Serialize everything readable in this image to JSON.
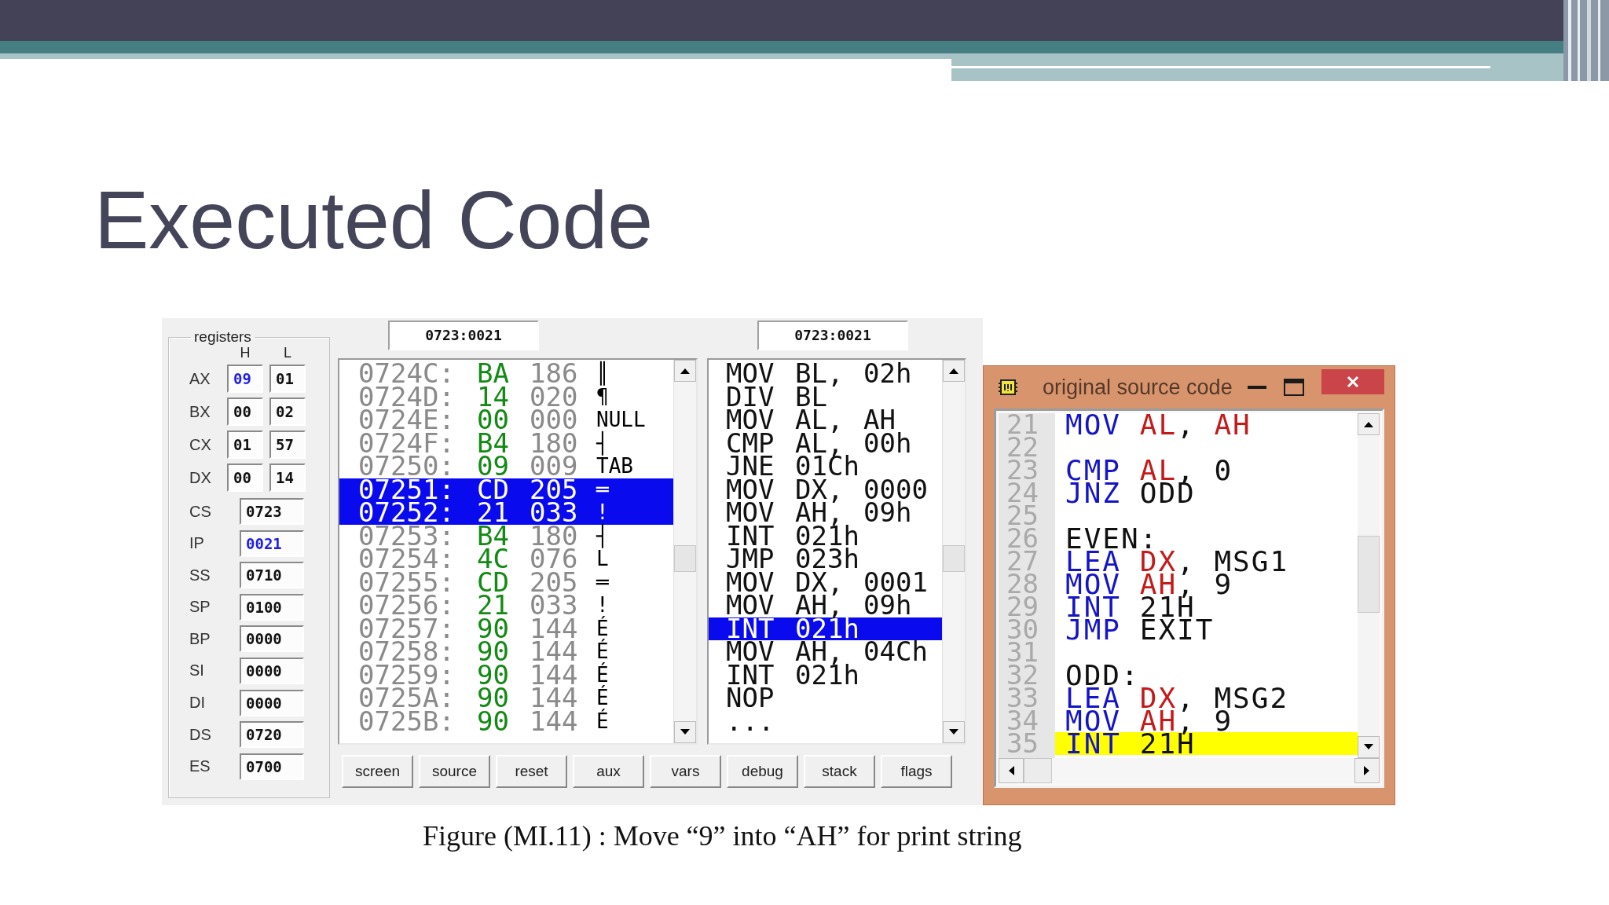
{
  "slide": {
    "title": "Executed Code",
    "caption": "Figure (MI.11) : Move “9” into “AH” for print string"
  },
  "emulator": {
    "registers": {
      "title": "registers",
      "columns": [
        "H",
        "L"
      ],
      "pairs": [
        {
          "name": "AX",
          "h": "09",
          "l": "01",
          "h_changed": true
        },
        {
          "name": "BX",
          "h": "00",
          "l": "02",
          "h_changed": false
        },
        {
          "name": "CX",
          "h": "01",
          "l": "57",
          "h_changed": false
        },
        {
          "name": "DX",
          "h": "00",
          "l": "14",
          "h_changed": false
        }
      ],
      "words": [
        {
          "name": "CS",
          "value": "0723",
          "changed": false
        },
        {
          "name": "IP",
          "value": "0021",
          "changed": true
        },
        {
          "name": "SS",
          "value": "0710",
          "changed": false
        },
        {
          "name": "SP",
          "value": "0100",
          "changed": false
        },
        {
          "name": "BP",
          "value": "0000",
          "changed": false
        },
        {
          "name": "SI",
          "value": "0000",
          "changed": false
        },
        {
          "name": "DI",
          "value": "0000",
          "changed": false
        },
        {
          "name": "DS",
          "value": "0720",
          "changed": false
        },
        {
          "name": "ES",
          "value": "0700",
          "changed": false
        }
      ]
    },
    "memory": {
      "address": "0723:0021",
      "rows": [
        {
          "address": "0724C:",
          "hex": "BA",
          "dec": "186",
          "char": "║",
          "selected": false
        },
        {
          "address": "0724D:",
          "hex": "14",
          "dec": "020",
          "char": "¶",
          "selected": false
        },
        {
          "address": "0724E:",
          "hex": "00",
          "dec": "000",
          "char": "NULL",
          "selected": false
        },
        {
          "address": "0724F:",
          "hex": "B4",
          "dec": "180",
          "char": "┤",
          "selected": false
        },
        {
          "address": "07250:",
          "hex": "09",
          "dec": "009",
          "char": "TAB",
          "selected": false
        },
        {
          "address": "07251:",
          "hex": "CD",
          "dec": "205",
          "char": "═",
          "selected": true
        },
        {
          "address": "07252:",
          "hex": "21",
          "dec": "033",
          "char": "!",
          "selected": true
        },
        {
          "address": "07253:",
          "hex": "B4",
          "dec": "180",
          "char": "┤",
          "selected": false
        },
        {
          "address": "07254:",
          "hex": "4C",
          "dec": "076",
          "char": "L",
          "selected": false
        },
        {
          "address": "07255:",
          "hex": "CD",
          "dec": "205",
          "char": "═",
          "selected": false
        },
        {
          "address": "07256:",
          "hex": "21",
          "dec": "033",
          "char": "!",
          "selected": false
        },
        {
          "address": "07257:",
          "hex": "90",
          "dec": "144",
          "char": "É",
          "selected": false
        },
        {
          "address": "07258:",
          "hex": "90",
          "dec": "144",
          "char": "É",
          "selected": false
        },
        {
          "address": "07259:",
          "hex": "90",
          "dec": "144",
          "char": "É",
          "selected": false
        },
        {
          "address": "0725A:",
          "hex": "90",
          "dec": "144",
          "char": "É",
          "selected": false
        },
        {
          "address": "0725B:",
          "hex": "90",
          "dec": "144",
          "char": "É",
          "selected": false
        }
      ]
    },
    "disassembly": {
      "address": "0723:0021",
      "rows": [
        {
          "op": "MOV",
          "arg1": "BL,",
          "arg2": "02h",
          "selected": false
        },
        {
          "op": "DIV",
          "arg1": "BL",
          "selected": false
        },
        {
          "op": "MOV",
          "arg1": "AL,",
          "arg2": "AH",
          "selected": false
        },
        {
          "op": "CMP",
          "arg1": "AL,",
          "arg2": "00h",
          "selected": false
        },
        {
          "op": "JNE",
          "arg1": "01Ch",
          "selected": false
        },
        {
          "op": "MOV",
          "arg1": "DX,",
          "arg2": "0000",
          "selected": false
        },
        {
          "op": "MOV",
          "arg1": "AH,",
          "arg2": "09h",
          "selected": false
        },
        {
          "op": "INT",
          "arg1": "021h",
          "selected": false
        },
        {
          "op": "JMP",
          "arg1": "023h",
          "selected": false
        },
        {
          "op": "MOV",
          "arg1": "DX,",
          "arg2": "0001",
          "selected": false
        },
        {
          "op": "MOV",
          "arg1": "AH,",
          "arg2": "09h",
          "selected": false
        },
        {
          "op": "INT",
          "arg1": "021h",
          "selected": true
        },
        {
          "op": "MOV",
          "arg1": "AH,",
          "arg2": "04Ch",
          "selected": false
        },
        {
          "op": "INT",
          "arg1": "021h",
          "selected": false
        },
        {
          "op": "NOP",
          "selected": false
        },
        {
          "op": "...",
          "selected": false
        }
      ]
    },
    "buttons": [
      "screen",
      "source",
      "reset",
      "aux",
      "vars",
      "debug",
      "stack",
      "flags"
    ]
  },
  "source_window": {
    "title": "original source code",
    "lines": [
      {
        "number": "21",
        "highlighted": false,
        "tokens": [
          {
            "text": "MOV",
            "kind": "keyword"
          },
          {
            "text": "AL",
            "kind": "register"
          },
          {
            "text": ",",
            "kind": "punct"
          },
          {
            "text": "AH",
            "kind": "register"
          }
        ]
      },
      {
        "number": "22",
        "highlighted": false
      },
      {
        "number": "23",
        "highlighted": false,
        "tokens": [
          {
            "text": "CMP",
            "kind": "keyword"
          },
          {
            "text": "AL",
            "kind": "register"
          },
          {
            "text": ",",
            "kind": "punct"
          },
          {
            "text": "0",
            "kind": "plain"
          }
        ]
      },
      {
        "number": "24",
        "highlighted": false,
        "tokens": [
          {
            "text": "JNZ",
            "kind": "keyword"
          },
          {
            "text": "ODD",
            "kind": "plain"
          }
        ]
      },
      {
        "number": "25",
        "highlighted": false
      },
      {
        "number": "26",
        "highlighted": false,
        "tokens": [
          {
            "text": "EVEN:",
            "kind": "plain"
          }
        ]
      },
      {
        "number": "27",
        "highlighted": false,
        "tokens": [
          {
            "text": "LEA",
            "kind": "keyword"
          },
          {
            "text": "DX",
            "kind": "register"
          },
          {
            "text": ",",
            "kind": "punct"
          },
          {
            "text": "MSG1",
            "kind": "plain"
          }
        ]
      },
      {
        "number": "28",
        "highlighted": false,
        "tokens": [
          {
            "text": "MOV",
            "kind": "keyword"
          },
          {
            "text": "AH",
            "kind": "register"
          },
          {
            "text": ",",
            "kind": "punct"
          },
          {
            "text": "9",
            "kind": "plain"
          }
        ]
      },
      {
        "number": "29",
        "highlighted": false,
        "tokens": [
          {
            "text": "INT",
            "kind": "keyword"
          },
          {
            "text": "21H",
            "kind": "plain"
          }
        ]
      },
      {
        "number": "30",
        "highlighted": false,
        "tokens": [
          {
            "text": "JMP",
            "kind": "keyword"
          },
          {
            "text": "EXIT",
            "kind": "plain"
          }
        ]
      },
      {
        "number": "31",
        "highlighted": false
      },
      {
        "number": "32",
        "highlighted": false,
        "tokens": [
          {
            "text": "ODD:",
            "kind": "plain"
          }
        ]
      },
      {
        "number": "33",
        "highlighted": false,
        "tokens": [
          {
            "text": "LEA",
            "kind": "keyword"
          },
          {
            "text": "DX",
            "kind": "register"
          },
          {
            "text": ",",
            "kind": "punct"
          },
          {
            "text": "MSG2",
            "kind": "plain"
          }
        ]
      },
      {
        "number": "34",
        "highlighted": false,
        "tokens": [
          {
            "text": "MOV",
            "kind": "keyword"
          },
          {
            "text": "AH",
            "kind": "register"
          },
          {
            "text": ",",
            "kind": "punct"
          },
          {
            "text": "9",
            "kind": "plain"
          }
        ]
      },
      {
        "number": "35",
        "highlighted": true,
        "tokens": [
          {
            "text": "INT",
            "kind": "keyword"
          },
          {
            "text": "21H",
            "kind": "plain"
          }
        ]
      }
    ]
  }
}
